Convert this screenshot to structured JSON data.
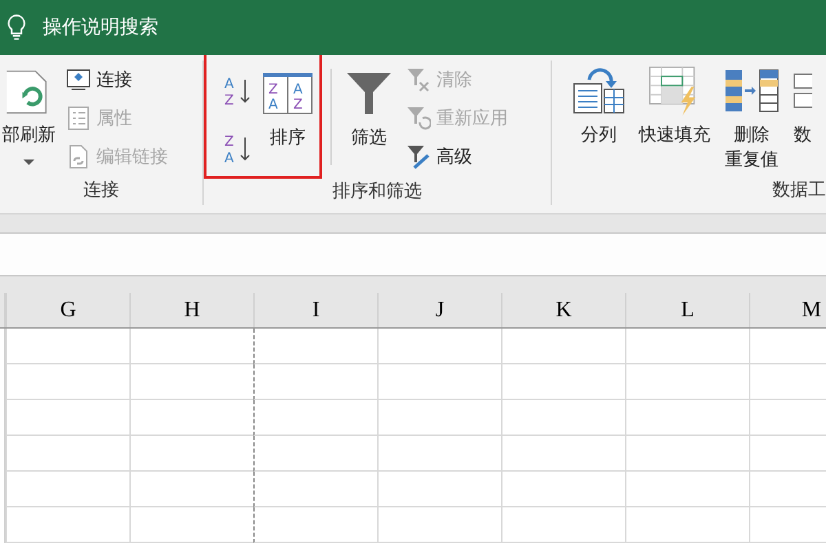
{
  "title_bar": {
    "search_label": "操作说明搜索"
  },
  "connections_group": {
    "label": "连接",
    "refresh_all": {
      "label": "部刷新"
    },
    "connections": {
      "label": "连接",
      "disabled": false
    },
    "properties": {
      "label": "属性",
      "disabled": true
    },
    "edit_links": {
      "label": "编辑链接",
      "disabled": true
    }
  },
  "sort_filter_group": {
    "label": "排序和筛选",
    "sort_highlighted": true,
    "sort_ascending": {
      "letters": [
        "A",
        "Z"
      ]
    },
    "sort_descending": {
      "letters": [
        "Z",
        "A"
      ]
    },
    "sort": {
      "label": "排序",
      "letters": [
        "Z",
        "A",
        "A",
        "Z"
      ]
    },
    "filter": {
      "label": "筛选"
    },
    "clear": {
      "label": "清除",
      "disabled": true
    },
    "reapply": {
      "label": "重新应用",
      "disabled": true
    },
    "advanced": {
      "label": "高级",
      "disabled": false
    }
  },
  "data_tools_group": {
    "label": "数据工",
    "text_to_columns": {
      "label": "分列"
    },
    "flash_fill": {
      "label": "快速填充"
    },
    "remove_duplicates": {
      "label_lines": [
        "删除",
        "重复值"
      ]
    },
    "data_validation": {
      "label": "数"
    }
  },
  "sheet": {
    "columns": [
      "G",
      "H",
      "I",
      "J",
      "K",
      "L",
      "M"
    ]
  }
}
